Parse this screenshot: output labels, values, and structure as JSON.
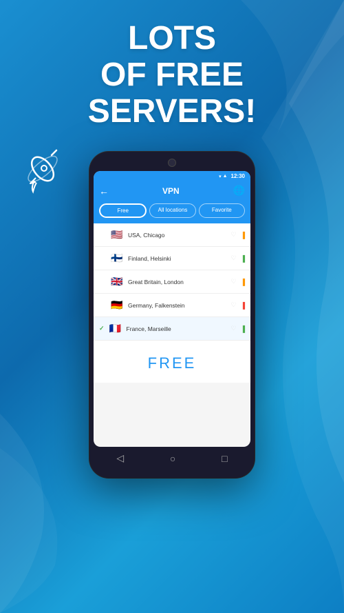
{
  "background": {
    "gradient_start": "#1a8fd1",
    "gradient_end": "#0d6aad"
  },
  "header": {
    "line1": "Lots",
    "line2": "of free",
    "line3": "servers!"
  },
  "phone": {
    "status_bar": {
      "time": "12:30"
    },
    "app_header": {
      "title": "VPN"
    },
    "tabs": [
      {
        "label": "Free",
        "active": true
      },
      {
        "label": "All locations",
        "active": false
      },
      {
        "label": "Favorite",
        "active": false
      }
    ],
    "servers": [
      {
        "country": "USA, Chicago",
        "flag_emoji": "🇺🇸",
        "signal_level": "medium",
        "selected": false
      },
      {
        "country": "Finland, Helsinki",
        "flag_emoji": "🇫🇮",
        "signal_level": "high",
        "selected": false
      },
      {
        "country": "Great Britain, London",
        "flag_emoji": "🇬🇧",
        "signal_level": "medium",
        "selected": false
      },
      {
        "country": "Germany, Falkenstein",
        "flag_emoji": "🇩🇪",
        "signal_level": "low",
        "selected": false
      },
      {
        "country": "France, Marseille",
        "flag_emoji": "🇫🇷",
        "signal_level": "high",
        "selected": true
      }
    ],
    "free_label": "FREE",
    "nav_buttons": [
      "◁",
      "○",
      "□"
    ]
  }
}
